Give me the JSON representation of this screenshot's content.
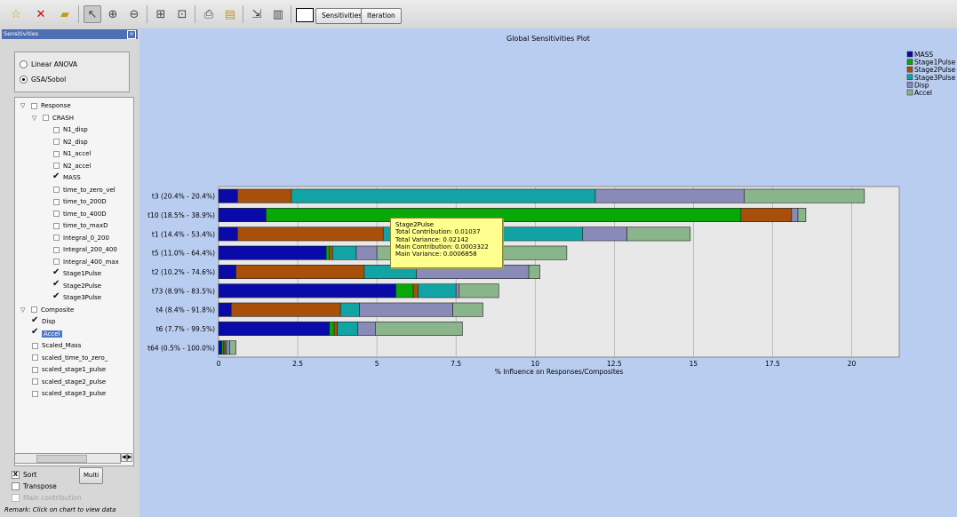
{
  "toolbar": {
    "icons": [
      "new-session-icon",
      "delete-icon",
      "open-folder-icon",
      "pointer-icon",
      "zoom-in-icon",
      "zoom-out-icon",
      "fit-view-icon",
      "center-view-icon",
      "print-icon",
      "print-preview-icon",
      "export-icon",
      "layout-icon"
    ],
    "tabs": [
      "Sensitivities",
      "Iteration"
    ]
  },
  "sidebar": {
    "title": "Sensitivities",
    "methods": [
      {
        "label": "Linear ANOVA",
        "selected": false
      },
      {
        "label": "GSA/Sobol",
        "selected": true
      }
    ],
    "tree": [
      {
        "label": "Response",
        "level": 0,
        "expanded": true,
        "checked": false
      },
      {
        "label": "CRASH",
        "level": 1,
        "expanded": true,
        "checked": false
      },
      {
        "label": "N1_disp",
        "level": 2,
        "checked": false
      },
      {
        "label": "N2_disp",
        "level": 2,
        "checked": false
      },
      {
        "label": "N1_accel",
        "level": 2,
        "checked": false
      },
      {
        "label": "N2_accel",
        "level": 2,
        "checked": false
      },
      {
        "label": "MASS",
        "level": 2,
        "checked": true
      },
      {
        "label": "time_to_zero_vel",
        "level": 2,
        "checked": false
      },
      {
        "label": "time_to_200D",
        "level": 2,
        "checked": false
      },
      {
        "label": "time_to_400D",
        "level": 2,
        "checked": false
      },
      {
        "label": "time_to_maxD",
        "level": 2,
        "checked": false
      },
      {
        "label": "Integral_0_200",
        "level": 2,
        "checked": false
      },
      {
        "label": "Integral_200_400",
        "level": 2,
        "checked": false
      },
      {
        "label": "Integral_400_max",
        "level": 2,
        "checked": false
      },
      {
        "label": "Stage1Pulse",
        "level": 2,
        "checked": true
      },
      {
        "label": "Stage2Pulse",
        "level": 2,
        "checked": true
      },
      {
        "label": "Stage3Pulse",
        "level": 2,
        "checked": true
      },
      {
        "label": "Composite",
        "level": 0,
        "expanded": true,
        "checked": false
      },
      {
        "label": "Disp",
        "level": 1,
        "checked": true
      },
      {
        "label": "Accel",
        "level": 1,
        "checked": true,
        "selected": true
      },
      {
        "label": "Scaled_Mass",
        "level": 1,
        "checked": false
      },
      {
        "label": "scaled_time_to_zero_",
        "level": 1,
        "checked": false
      },
      {
        "label": "scaled_stage1_pulse",
        "level": 1,
        "checked": false
      },
      {
        "label": "scaled_stage2_pulse",
        "level": 1,
        "checked": false
      },
      {
        "label": "scaled_stage3_pulse",
        "level": 1,
        "checked": false
      }
    ],
    "options": [
      {
        "label": "Sort",
        "mark": "X",
        "disabled": false
      },
      {
        "label": "Transpose",
        "mark": "",
        "disabled": false
      },
      {
        "label": "Main contribution",
        "mark": "",
        "disabled": true
      }
    ],
    "multi_label": "Multi",
    "remark": "Remark: Click on chart to view data"
  },
  "tooltip": {
    "lines": [
      "Stage2Pulse",
      "Total Contribution: 0.01037",
      "Total Variance: 0.02142",
      "Main Contribution: 0.0003322",
      "Main Variance: 0.0006858"
    ]
  },
  "chart_data": {
    "type": "bar",
    "orientation": "horizontal",
    "stacked": true,
    "title": "Global Sensitivities Plot",
    "xlabel": "% Influence on Responses/Composites",
    "ylabel": "",
    "xlim": [
      0,
      21.5
    ],
    "xticks": [
      0,
      2.5,
      5,
      7.5,
      10,
      12.5,
      15,
      17.5,
      20
    ],
    "xtick_labels": [
      "0",
      "2.5",
      "5",
      "7.5",
      "10",
      "12.5",
      "15",
      "17.5",
      "20"
    ],
    "grid": true,
    "legend_position": "top-right",
    "categories": [
      "t3 (20.4% - 20.4%)",
      "t10 (18.5% - 38.9%)",
      "t1 (14.4% - 53.4%)",
      "t5 (11.0% - 64.4%)",
      "t2 (10.2% - 74.6%)",
      "t73 (8.9% - 83.5%)",
      "t4 (8.4% - 91.8%)",
      "t6 (7.7% - 99.5%)",
      "t64 (0.5% - 100.0%)"
    ],
    "series": [
      {
        "name": "MASS",
        "color": "#0a0aa8",
        "values": [
          0.6,
          1.5,
          0.6,
          3.4,
          0.55,
          5.6,
          0.4,
          3.5,
          0.1
        ]
      },
      {
        "name": "Stage1Pulse",
        "color": "#08a808",
        "values": [
          0.0,
          15.0,
          0.0,
          0.1,
          0.0,
          0.55,
          0.0,
          0.15,
          0.05
        ]
      },
      {
        "name": "Stage2Pulse",
        "color": "#a8500a",
        "values": [
          1.7,
          1.6,
          4.6,
          0.1,
          4.05,
          0.15,
          3.45,
          0.1,
          0.05
        ]
      },
      {
        "name": "Stage3Pulse",
        "color": "#12a4a4",
        "values": [
          9.6,
          0.0,
          6.3,
          0.75,
          1.65,
          1.2,
          0.6,
          0.65,
          0.05
        ]
      },
      {
        "name": "Disp",
        "color": "#8a8ab8",
        "values": [
          4.7,
          0.2,
          1.4,
          0.65,
          3.55,
          0.1,
          2.95,
          0.55,
          0.1
        ]
      },
      {
        "name": "Accel",
        "color": "#8ab48a",
        "values": [
          3.8,
          0.25,
          2.0,
          6.0,
          0.35,
          1.25,
          0.95,
          2.75,
          0.2
        ]
      }
    ]
  }
}
